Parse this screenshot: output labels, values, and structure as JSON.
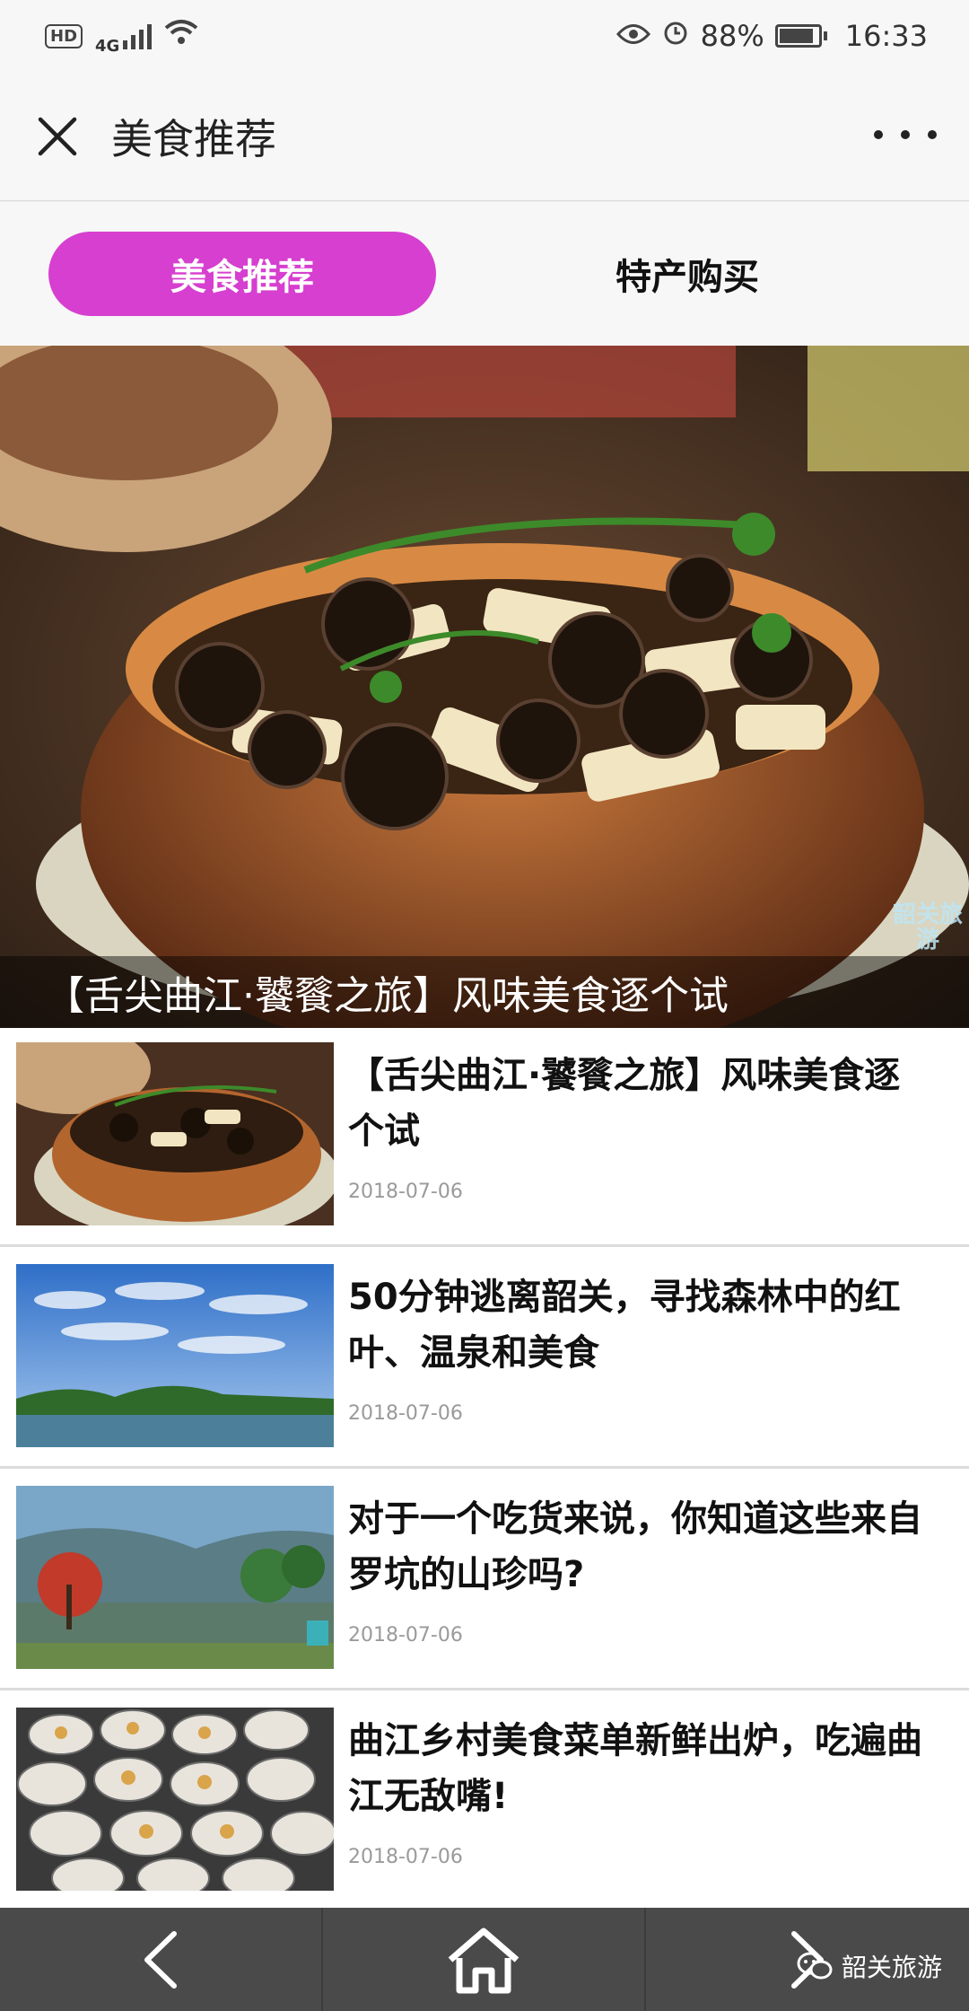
{
  "status_bar": {
    "hd": "HD",
    "network": "4G",
    "battery": "88%",
    "battery_level": 0.88,
    "time": "16:33"
  },
  "header": {
    "title": "美食推荐"
  },
  "tabs": [
    {
      "label": "美食推荐",
      "active": true
    },
    {
      "label": "特产购买",
      "active": false
    }
  ],
  "hero": {
    "caption": "【舌尖曲江·饕餮之旅】风味美食逐个试",
    "watermark": "韶关旅游"
  },
  "articles": [
    {
      "title": "【舌尖曲江·饕餮之旅】风味美食逐个试",
      "date": "2018-07-06"
    },
    {
      "title": "50分钟逃离韶关，寻找森林中的红叶、温泉和美食",
      "date": "2018-07-06"
    },
    {
      "title": "对于一个吃货来说，你知道这些来自罗坑的山珍吗?",
      "date": "2018-07-06"
    },
    {
      "title": "曲江乡村美食菜单新鲜出炉，吃遍曲江无敌嘴!",
      "date": "2018-07-06"
    }
  ],
  "bottom_bar": {
    "watermark": "韶关旅游"
  },
  "colors": {
    "accent": "#d63fcf",
    "bottom_bar": "#4a4a4a"
  }
}
